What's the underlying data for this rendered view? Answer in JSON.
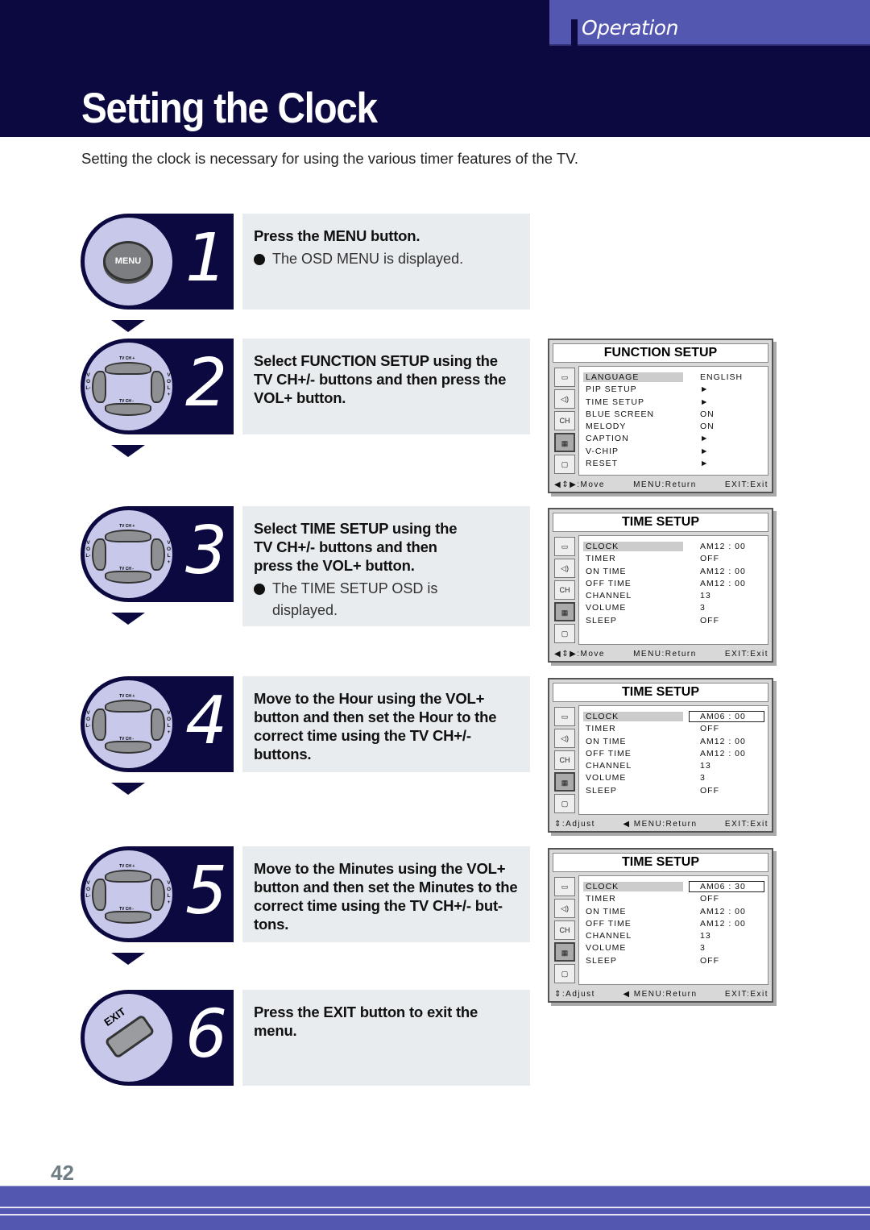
{
  "header": {
    "section": "Operation",
    "title": "Setting the Clock",
    "intro": "Setting the clock is necessary for using the various timer features of the TV."
  },
  "steps": [
    {
      "number": "1",
      "icon": "menu-button",
      "icon_label": "MENU",
      "text": "Press the MENU button.",
      "bullet": "The OSD MENU is displayed."
    },
    {
      "number": "2",
      "icon": "dpad",
      "dpad_labels": {
        "top": "TV CH +",
        "bottom": "TV CH -",
        "left": "VOL-",
        "right": "VOL+"
      },
      "text": "Select FUNCTION SETUP using the\nTV CH+/- buttons and then press the\nVOL+ button."
    },
    {
      "number": "3",
      "icon": "dpad",
      "dpad_labels": {
        "top": "TV CH +",
        "bottom": "TV CH -",
        "left": "VOL-",
        "right": "VOL+"
      },
      "text": "Select TIME SETUP using the\nTV CH+/- buttons and then\npress the VOL+ button.",
      "bullet": "The TIME SETUP OSD is\ndisplayed."
    },
    {
      "number": "4",
      "icon": "dpad",
      "dpad_labels": {
        "top": "TV CH +",
        "bottom": "TV CH -",
        "left": "VOL-",
        "right": "VOL+"
      },
      "text": "Move to the Hour using the VOL+\nbutton and then set the Hour to the\ncorrect time using the TV CH+/- buttons."
    },
    {
      "number": "5",
      "icon": "dpad",
      "dpad_labels": {
        "top": "TV CH +",
        "bottom": "TV CH -",
        "left": "VOL-",
        "right": "VOL+"
      },
      "text": "Move to the Minutes using the VOL+\nbutton and then set the Minutes to the\ncorrect time using the TV CH+/- but-\ntons."
    },
    {
      "number": "6",
      "icon": "exit-button",
      "icon_label": "EXIT",
      "text": "Press the EXIT button to exit the\nmenu."
    }
  ],
  "osd_panels": [
    {
      "title": "FUNCTION SETUP",
      "rows": [
        {
          "label": "LANGUAGE",
          "value": "ENGLISH",
          "highlighted": true
        },
        {
          "label": "PIP SETUP",
          "value": "►"
        },
        {
          "label": "TIME SETUP",
          "value": "►"
        },
        {
          "label": "BLUE SCREEN",
          "value": "ON"
        },
        {
          "label": "MELODY",
          "value": "ON"
        },
        {
          "label": "CAPTION",
          "value": "►"
        },
        {
          "label": "V-CHIP",
          "value": "►"
        },
        {
          "label": "RESET",
          "value": "►"
        }
      ],
      "footer": [
        "◀⇕▶:Move",
        "MENU:Return",
        "EXIT:Exit"
      ]
    },
    {
      "title": "TIME SETUP",
      "rows": [
        {
          "label": "CLOCK",
          "value": "AM12 : 00",
          "highlighted": true
        },
        {
          "label": "TIMER",
          "value": "OFF"
        },
        {
          "label": "ON TIME",
          "value": "AM12 : 00"
        },
        {
          "label": "OFF TIME",
          "value": "AM12 : 00"
        },
        {
          "label": "CHANNEL",
          "value": "13"
        },
        {
          "label": "VOLUME",
          "value": "3"
        },
        {
          "label": "SLEEP",
          "value": "OFF"
        }
      ],
      "footer": [
        "◀⇕▶:Move",
        "MENU:Return",
        "EXIT:Exit"
      ]
    },
    {
      "title": "TIME SETUP",
      "rows": [
        {
          "label": "CLOCK",
          "value": "AM06 : 00",
          "highlighted": true,
          "boxed": true
        },
        {
          "label": "TIMER",
          "value": "OFF"
        },
        {
          "label": "ON TIME",
          "value": "AM12 : 00"
        },
        {
          "label": "OFF TIME",
          "value": "AM12 : 00"
        },
        {
          "label": "CHANNEL",
          "value": "13"
        },
        {
          "label": "VOLUME",
          "value": "3"
        },
        {
          "label": "SLEEP",
          "value": "OFF"
        }
      ],
      "footer": [
        "⇕:Adjust",
        "◀ MENU:Return",
        "EXIT:Exit"
      ]
    },
    {
      "title": "TIME SETUP",
      "rows": [
        {
          "label": "CLOCK",
          "value": "AM06 : 30",
          "highlighted": true,
          "boxed": true
        },
        {
          "label": "TIMER",
          "value": "OFF"
        },
        {
          "label": "ON TIME",
          "value": "AM12 : 00"
        },
        {
          "label": "OFF TIME",
          "value": "AM12 : 00"
        },
        {
          "label": "CHANNEL",
          "value": "13"
        },
        {
          "label": "VOLUME",
          "value": "3"
        },
        {
          "label": "SLEEP",
          "value": "OFF"
        }
      ],
      "footer": [
        "⇕:Adjust",
        "◀ MENU:Return",
        "EXIT:Exit"
      ]
    }
  ],
  "osd_side_icons": [
    "tv-picture-icon",
    "speaker-sound-icon",
    "antenna-channel-icon",
    "function-setup-icon",
    "pc-icon"
  ],
  "osd_side_icon_text": {
    "channel": "CH"
  },
  "page_number": "42",
  "colors": {
    "navy": "#0c0940",
    "accent": "#5457b0",
    "circle": "#c7c8ea",
    "text_box": "#e9ecee"
  }
}
